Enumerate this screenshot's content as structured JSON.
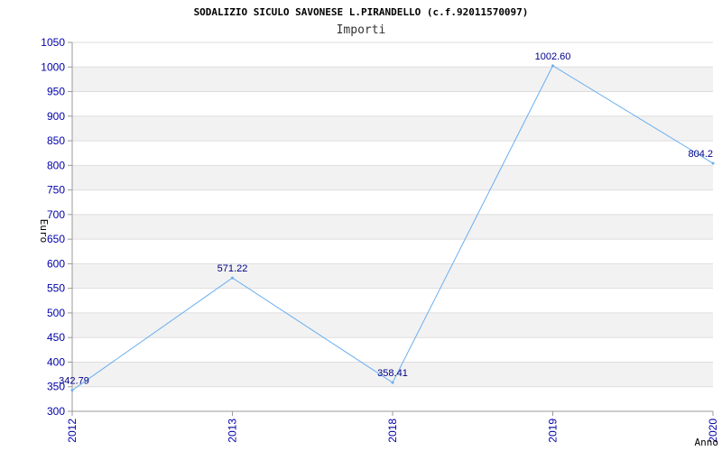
{
  "chart_data": {
    "type": "line",
    "title": "SODALIZIO SICULO SAVONESE L.PIRANDELLO (c.f.92011570097)",
    "subtitle": "Importi",
    "xlabel": "Anno",
    "ylabel": "Euro",
    "categories": [
      "2012",
      "2013",
      "2018",
      "2019",
      "2020"
    ],
    "series": [
      {
        "values": [
          342.79,
          571.22,
          358.41,
          1002.6,
          804.2
        ]
      }
    ],
    "data_labels": [
      "342.79",
      "571.22",
      "358.41",
      "1002.60",
      "804.2"
    ],
    "ylim": [
      300,
      1050
    ],
    "yticks": [
      "300",
      "350",
      "400",
      "450",
      "500",
      "550",
      "600",
      "650",
      "700",
      "750",
      "800",
      "850",
      "900",
      "950",
      "1000",
      "1050"
    ],
    "grid": true,
    "colors": {
      "line": "#6aaef0",
      "band": "#f2f2f2",
      "grid": "#dddddd",
      "axis": "#999999",
      "tick_text": "#0000aa",
      "label_text": "#000088"
    }
  }
}
